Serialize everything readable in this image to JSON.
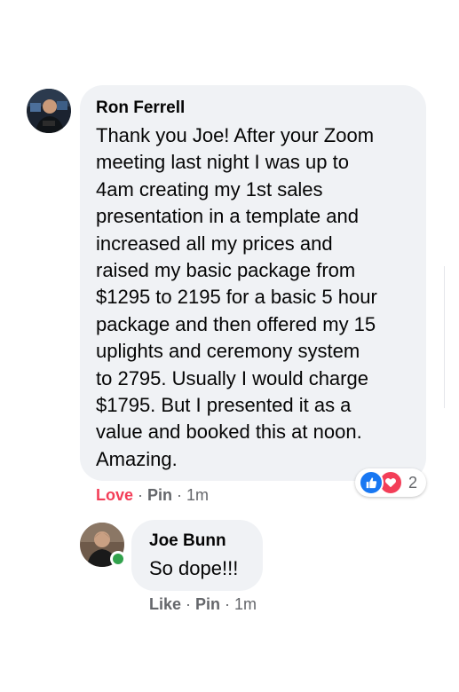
{
  "comments": [
    {
      "author": "Ron Ferrell",
      "text": "Thank you Joe! After your Zoom\nmeeting last night I was up to\n4am creating my 1st sales\npresentation in a template and\nincreased all my prices and\nraised my basic package from\n$1295 to 2195 for a basic 5 hour\npackage and then offered my 15\nuplights and ceremony system\nto 2795. Usually I would charge\n$1795. But I presented it as a\nvalue and booked this at noon.\nAmazing.",
      "actions": {
        "reaction_label": "Love",
        "pin_label": "Pin",
        "timestamp": "1m"
      },
      "reactions": {
        "icons": [
          "like-icon",
          "love-icon"
        ],
        "count": "2"
      },
      "avatar_icon": "profile-photo"
    },
    {
      "author": "Joe Bunn",
      "text": "So dope!!!",
      "online": true,
      "actions": {
        "reaction_label": "Like",
        "pin_label": "Pin",
        "timestamp": "1m"
      },
      "avatar_icon": "profile-photo"
    }
  ],
  "separator": "·",
  "colors": {
    "bubble_bg": "#f0f2f5",
    "love_red": "#f33e58",
    "like_blue": "#1877f2",
    "muted_text": "#65676b",
    "online_green": "#31a24c"
  }
}
